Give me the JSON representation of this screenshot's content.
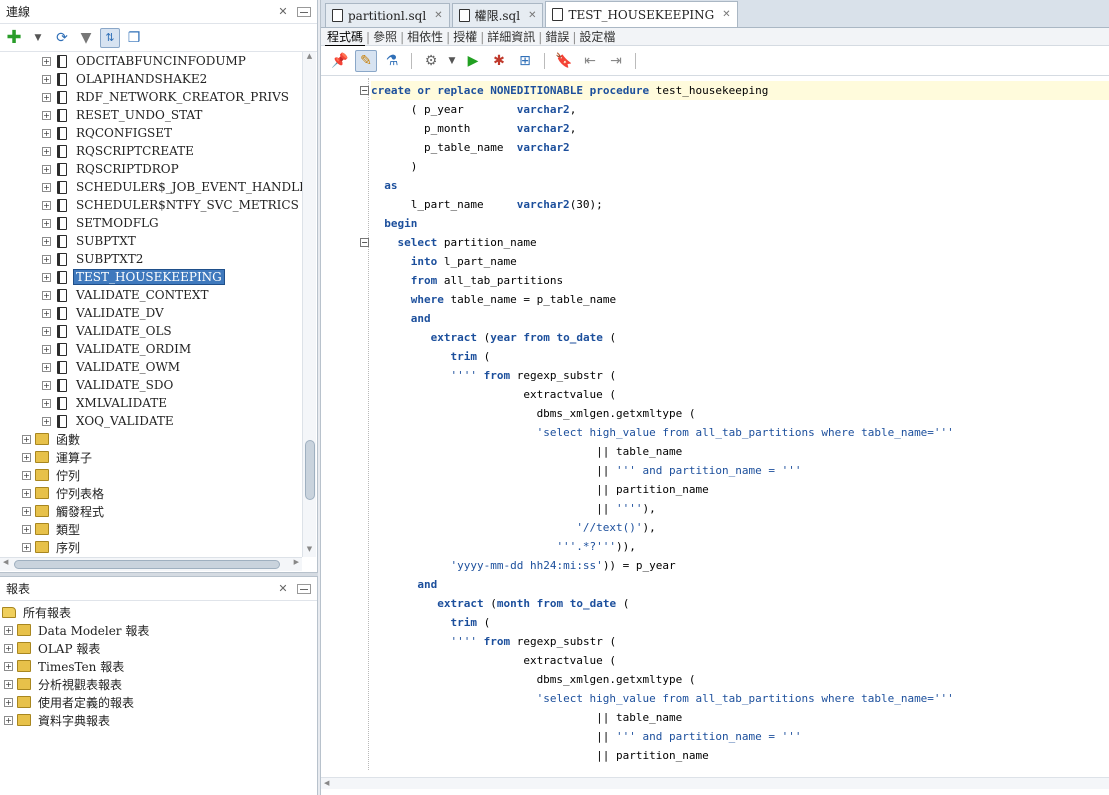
{
  "connections": {
    "title": "連線",
    "tree": [
      {
        "label": "ODCITABFUNCINFODUMP",
        "level": 3,
        "icon": "procedure",
        "selected": false
      },
      {
        "label": "OLAPIHANDSHAKE2",
        "level": 3,
        "icon": "procedure",
        "selected": false
      },
      {
        "label": "RDF_NETWORK_CREATOR_PRIVS",
        "level": 3,
        "icon": "procedure",
        "selected": false
      },
      {
        "label": "RESET_UNDO_STAT",
        "level": 3,
        "icon": "procedure",
        "selected": false
      },
      {
        "label": "RQCONFIGSET",
        "level": 3,
        "icon": "procedure",
        "selected": false
      },
      {
        "label": "RQSCRIPTCREATE",
        "level": 3,
        "icon": "procedure",
        "selected": false
      },
      {
        "label": "RQSCRIPTDROP",
        "level": 3,
        "icon": "procedure",
        "selected": false
      },
      {
        "label": "SCHEDULER$_JOB_EVENT_HANDLER",
        "level": 3,
        "icon": "procedure",
        "selected": false
      },
      {
        "label": "SCHEDULER$NTFY_SVC_METRICS",
        "level": 3,
        "icon": "procedure",
        "selected": false
      },
      {
        "label": "SETMODFLG",
        "level": 3,
        "icon": "procedure",
        "selected": false
      },
      {
        "label": "SUBPTXT",
        "level": 3,
        "icon": "procedure",
        "selected": false
      },
      {
        "label": "SUBPTXT2",
        "level": 3,
        "icon": "procedure",
        "selected": false
      },
      {
        "label": "TEST_HOUSEKEEPING",
        "level": 3,
        "icon": "procedure",
        "selected": true
      },
      {
        "label": "VALIDATE_CONTEXT",
        "level": 3,
        "icon": "procedure",
        "selected": false
      },
      {
        "label": "VALIDATE_DV",
        "level": 3,
        "icon": "procedure",
        "selected": false
      },
      {
        "label": "VALIDATE_OLS",
        "level": 3,
        "icon": "procedure",
        "selected": false
      },
      {
        "label": "VALIDATE_ORDIM",
        "level": 3,
        "icon": "procedure",
        "selected": false
      },
      {
        "label": "VALIDATE_OWM",
        "level": 3,
        "icon": "procedure",
        "selected": false
      },
      {
        "label": "VALIDATE_SDO",
        "level": 3,
        "icon": "procedure",
        "selected": false
      },
      {
        "label": "XMLVALIDATE",
        "level": 3,
        "icon": "procedure",
        "selected": false
      },
      {
        "label": "XOQ_VALIDATE",
        "level": 3,
        "icon": "procedure",
        "selected": false
      },
      {
        "label": "函數",
        "level": 2,
        "icon": "folder",
        "selected": false
      },
      {
        "label": "運算子",
        "level": 2,
        "icon": "folder",
        "selected": false
      },
      {
        "label": "佇列",
        "level": 2,
        "icon": "folder",
        "selected": false
      },
      {
        "label": "佇列表格",
        "level": 2,
        "icon": "folder",
        "selected": false
      },
      {
        "label": "觸發程式",
        "level": 2,
        "icon": "folder",
        "selected": false
      },
      {
        "label": "類型",
        "level": 2,
        "icon": "folder",
        "selected": false
      },
      {
        "label": "序列",
        "level": 2,
        "icon": "folder",
        "selected": false
      }
    ]
  },
  "reports": {
    "title": "報表",
    "root": "所有報表",
    "items": [
      "Data Modeler 報表",
      "OLAP 報表",
      "TimesTen 報表",
      "分析視觀表報表",
      "使用者定義的報表",
      "資料字典報表"
    ]
  },
  "editor": {
    "tabs": [
      {
        "label": "partitionl.sql",
        "active": false
      },
      {
        "label": "權限.sql",
        "active": false
      },
      {
        "label": "TEST_HOUSEKEEPING",
        "active": true
      }
    ],
    "subtabs": [
      {
        "label": "程式碼",
        "active": true
      },
      {
        "label": "參照",
        "active": false
      },
      {
        "label": "相依性",
        "active": false
      },
      {
        "label": "授權",
        "active": false
      },
      {
        "label": "詳細資訊",
        "active": false
      },
      {
        "label": "錯誤",
        "active": false
      },
      {
        "label": "設定檔",
        "active": false
      }
    ],
    "code": [
      {
        "fold": true,
        "hl": true,
        "tokens": [
          [
            "kw",
            "create"
          ],
          [
            "t",
            " "
          ],
          [
            "kw",
            "or"
          ],
          [
            "t",
            " "
          ],
          [
            "kw",
            "replace"
          ],
          [
            "t",
            " "
          ],
          [
            "kw",
            "NONEDITIONABLE"
          ],
          [
            "t",
            " "
          ],
          [
            "kw",
            "procedure"
          ],
          [
            "t",
            " test_housekeeping"
          ]
        ]
      },
      {
        "tokens": [
          [
            "t",
            "      ( p_year        "
          ],
          [
            "kw",
            "varchar2"
          ],
          [
            "t",
            ","
          ]
        ]
      },
      {
        "tokens": [
          [
            "t",
            "        p_month       "
          ],
          [
            "kw",
            "varchar2"
          ],
          [
            "t",
            ","
          ]
        ]
      },
      {
        "tokens": [
          [
            "t",
            "        p_table_name  "
          ],
          [
            "kw",
            "varchar2"
          ]
        ]
      },
      {
        "tokens": [
          [
            "t",
            "      )"
          ]
        ]
      },
      {
        "tokens": [
          [
            "t",
            "  "
          ],
          [
            "kw",
            "as"
          ]
        ]
      },
      {
        "tokens": [
          [
            "t",
            "      l_part_name     "
          ],
          [
            "kw",
            "varchar2"
          ],
          [
            "t",
            "(30);"
          ]
        ]
      },
      {
        "tokens": [
          [
            "t",
            "  "
          ],
          [
            "kw",
            "begin"
          ]
        ]
      },
      {
        "fold": true,
        "tokens": [
          [
            "t",
            "    "
          ],
          [
            "kw",
            "select"
          ],
          [
            "t",
            " partition_name"
          ]
        ]
      },
      {
        "tokens": [
          [
            "t",
            "      "
          ],
          [
            "kw",
            "into"
          ],
          [
            "t",
            " l_part_name"
          ]
        ]
      },
      {
        "tokens": [
          [
            "t",
            "      "
          ],
          [
            "kw",
            "from"
          ],
          [
            "t",
            " all_tab_partitions"
          ]
        ]
      },
      {
        "tokens": [
          [
            "t",
            "      "
          ],
          [
            "kw",
            "where"
          ],
          [
            "t",
            " table_name = p_table_name"
          ]
        ]
      },
      {
        "tokens": [
          [
            "t",
            "      "
          ],
          [
            "kw",
            "and"
          ]
        ]
      },
      {
        "tokens": [
          [
            "t",
            "         "
          ],
          [
            "kw",
            "extract"
          ],
          [
            "t",
            " ("
          ],
          [
            "kw",
            "year"
          ],
          [
            "t",
            " "
          ],
          [
            "kw",
            "from"
          ],
          [
            "t",
            " "
          ],
          [
            "kw",
            "to_date"
          ],
          [
            "t",
            " ("
          ]
        ]
      },
      {
        "tokens": [
          [
            "t",
            "            "
          ],
          [
            "kw",
            "trim"
          ],
          [
            "t",
            " ("
          ]
        ]
      },
      {
        "tokens": [
          [
            "t",
            "            "
          ],
          [
            "str",
            "''''"
          ],
          [
            "t",
            " "
          ],
          [
            "kw",
            "from"
          ],
          [
            "t",
            " regexp_substr ("
          ]
        ]
      },
      {
        "tokens": [
          [
            "t",
            "                       extractvalue ("
          ]
        ]
      },
      {
        "tokens": [
          [
            "t",
            "                         dbms_xmlgen.getxmltype ("
          ]
        ]
      },
      {
        "tokens": [
          [
            "t",
            "                         "
          ],
          [
            "str",
            "'select high_value from all_tab_partitions where table_name='''"
          ]
        ]
      },
      {
        "tokens": [
          [
            "t",
            "                                  || table_name"
          ]
        ]
      },
      {
        "tokens": [
          [
            "t",
            "                                  || "
          ],
          [
            "str",
            "''' and partition_name = '''"
          ]
        ]
      },
      {
        "tokens": [
          [
            "t",
            "                                  || partition_name"
          ]
        ]
      },
      {
        "tokens": [
          [
            "t",
            "                                  || "
          ],
          [
            "str",
            "''''"
          ],
          [
            "t",
            "),"
          ]
        ]
      },
      {
        "tokens": [
          [
            "t",
            "                               "
          ],
          [
            "str",
            "'//text()'"
          ],
          [
            "t",
            "),"
          ]
        ]
      },
      {
        "tokens": [
          [
            "t",
            "                            "
          ],
          [
            "str",
            "'''.*?'''"
          ],
          [
            "t",
            ")),"
          ]
        ]
      },
      {
        "tokens": [
          [
            "t",
            "            "
          ],
          [
            "str",
            "'yyyy-mm-dd hh24:mi:ss'"
          ],
          [
            "t",
            ")) = p_year"
          ]
        ]
      },
      {
        "tokens": [
          [
            "t",
            "       "
          ],
          [
            "kw",
            "and"
          ]
        ]
      },
      {
        "tokens": [
          [
            "t",
            "          "
          ],
          [
            "kw",
            "extract"
          ],
          [
            "t",
            " ("
          ],
          [
            "kw",
            "month"
          ],
          [
            "t",
            " "
          ],
          [
            "kw",
            "from"
          ],
          [
            "t",
            " "
          ],
          [
            "kw",
            "to_date"
          ],
          [
            "t",
            " ("
          ]
        ]
      },
      {
        "tokens": [
          [
            "t",
            "            "
          ],
          [
            "kw",
            "trim"
          ],
          [
            "t",
            " ("
          ]
        ]
      },
      {
        "tokens": [
          [
            "t",
            "            "
          ],
          [
            "str",
            "''''"
          ],
          [
            "t",
            " "
          ],
          [
            "kw",
            "from"
          ],
          [
            "t",
            " regexp_substr ("
          ]
        ]
      },
      {
        "tokens": [
          [
            "t",
            "                       extractvalue ("
          ]
        ]
      },
      {
        "tokens": [
          [
            "t",
            "                         dbms_xmlgen.getxmltype ("
          ]
        ]
      },
      {
        "tokens": [
          [
            "t",
            "                         "
          ],
          [
            "str",
            "'select high_value from all_tab_partitions where table_name='''"
          ]
        ]
      },
      {
        "tokens": [
          [
            "t",
            "                                  || table_name"
          ]
        ]
      },
      {
        "tokens": [
          [
            "t",
            "                                  || "
          ],
          [
            "str",
            "''' and partition_name = '''"
          ]
        ]
      },
      {
        "tokens": [
          [
            "t",
            "                                  || partition_name"
          ]
        ]
      }
    ]
  }
}
